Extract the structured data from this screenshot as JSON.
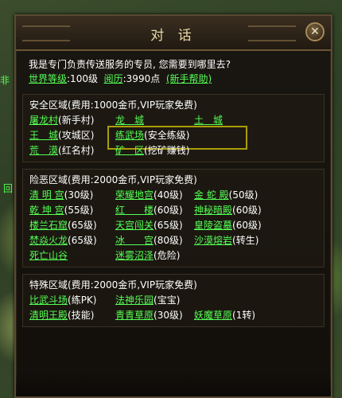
{
  "window": {
    "title": "对 话",
    "close_icon": "close-icon"
  },
  "intro": {
    "greeting": "我是专门负责传送服务的专员, 您需要到哪里去?",
    "level_link": "世界等级",
    "level_value": ":100级",
    "exp_link": "阅历",
    "exp_value": ":3990点",
    "help_link": "(新手帮助)"
  },
  "safe_zone": {
    "header": "安全区域(费用:1000金币,VIP玩家免费)",
    "rows": [
      [
        {
          "name": "屠龙村",
          "note": "(新手村)"
        },
        {
          "name": "龙　城",
          "note": ""
        },
        {
          "name": "土　城",
          "note": ""
        }
      ],
      [
        {
          "name": "王　城",
          "note": "(攻城区)"
        },
        {
          "name": "练武场",
          "note": "(安全练级)"
        }
      ],
      [
        {
          "name": "荒　漠",
          "note": "(红名村)"
        },
        {
          "name": "矿　区",
          "note": "(挖矿赚钱)"
        }
      ]
    ]
  },
  "danger_zone": {
    "header": "险恶区域(费用:2000金币,VIP玩家免费)",
    "rows": [
      [
        {
          "name": "清 明 宫",
          "note": "(30级)"
        },
        {
          "name": "荣耀地宫",
          "note": "(40级)"
        },
        {
          "name": "金 蛇 殿",
          "note": "(50级)"
        }
      ],
      [
        {
          "name": "乾 坤 宫",
          "note": "(55级)"
        },
        {
          "name": "红　　楼",
          "note": "(60级)"
        },
        {
          "name": "神秘暗殿",
          "note": "(60级)"
        }
      ],
      [
        {
          "name": "楼兰石窟",
          "note": "(65级)"
        },
        {
          "name": "天宫闯关",
          "note": "(65级)"
        },
        {
          "name": "皇陵盗墓",
          "note": "(60级)"
        }
      ],
      [
        {
          "name": "焚焱火龙",
          "note": "(65级)"
        },
        {
          "name": "冰　　宫",
          "note": "(80级)"
        },
        {
          "name": "沙漠熔岩",
          "note": "(转生)"
        }
      ],
      [
        {
          "name": "死亡山谷",
          "note": ""
        },
        {
          "name": "迷雾沼泽",
          "note": "(危险)"
        }
      ]
    ]
  },
  "special_zone": {
    "header": "特殊区域(费用:2000金币,VIP玩家免费)",
    "rows": [
      [
        {
          "name": "比武斗场",
          "note": "(练PK)"
        },
        {
          "name": "法神乐园",
          "note": "(宝宝)"
        }
      ],
      [
        {
          "name": "清明王殿",
          "note": "(技能)"
        },
        {
          "name": "青青草原",
          "note": "(30级)"
        },
        {
          "name": "妖魔草原",
          "note": "(1转)"
        }
      ]
    ]
  },
  "scenery": {
    "left_glyph_top": "非",
    "left_glyph_mid": "回"
  }
}
